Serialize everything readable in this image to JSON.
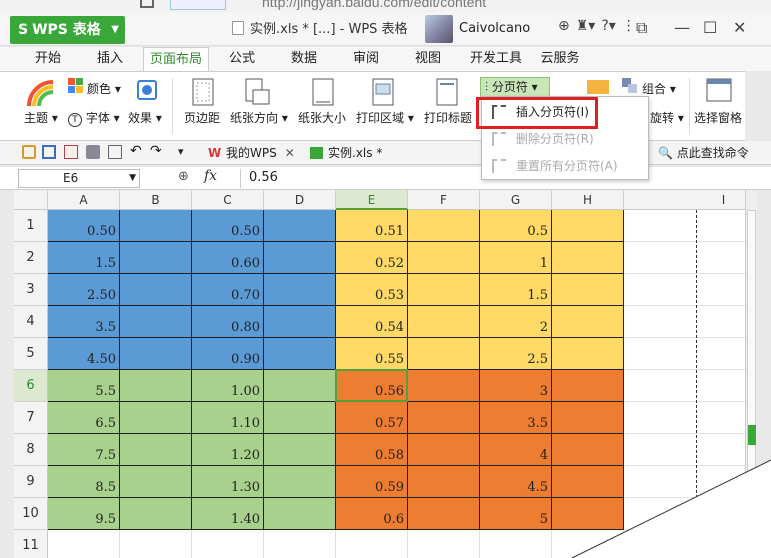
{
  "browser": {
    "url": "http://jingyan.baidu.com/edit/content"
  },
  "titlebar": {
    "app_button": "WPS 表格",
    "doc_title": "实例.xls * [...] - WPS 表格",
    "username": "Caivolcano"
  },
  "tabs": [
    "开始",
    "插入",
    "页面布局",
    "公式",
    "数据",
    "审阅",
    "视图",
    "开发工具",
    "云服务"
  ],
  "active_tab": "页面布局",
  "ribbon": {
    "theme": "主题",
    "color": "颜色",
    "font": "字体",
    "effect": "效果",
    "margins": "页边距",
    "orientation": "纸张方向",
    "size": "纸张大小",
    "print_area": "打印区域",
    "print_titles": "打印标题",
    "page_break": "分页符",
    "group": "组合",
    "rotate": "旋转",
    "selection_pane": "选择窗格"
  },
  "page_break_menu": {
    "insert": "插入分页符(I)",
    "delete": "删除分页符(R)",
    "reset": "重置所有分页符(A)"
  },
  "quickbar": {
    "tab1": "我的WPS",
    "tab2": "实例.xls *",
    "find": "点此查找命令"
  },
  "formula_bar": {
    "cell_ref": "E6",
    "fx": "fx",
    "value": "0.56"
  },
  "columns": [
    "A",
    "B",
    "C",
    "D",
    "E",
    "F",
    "G",
    "H",
    "I"
  ],
  "rows": [
    "1",
    "2",
    "3",
    "4",
    "5",
    "6",
    "7",
    "8",
    "9",
    "10",
    "11"
  ],
  "cells": {
    "A": [
      "0.50",
      "1.5",
      "2.50",
      "3.5",
      "4.50",
      "5.5",
      "6.5",
      "7.5",
      "8.5",
      "9.5"
    ],
    "C": [
      "0.50",
      "0.60",
      "0.70",
      "0.80",
      "0.90",
      "1.00",
      "1.10",
      "1.20",
      "1.30",
      "1.40"
    ],
    "E": [
      "0.51",
      "0.52",
      "0.53",
      "0.54",
      "0.55",
      "0.56",
      "0.57",
      "0.58",
      "0.59",
      "0.6"
    ],
    "G": [
      "0.5",
      "1",
      "1.5",
      "2",
      "2.5",
      "3",
      "3.5",
      "4",
      "4.5",
      "5"
    ]
  },
  "colors": {
    "blue": "#5b9bd5",
    "green": "#a9d18e",
    "yellow": "#ffd966",
    "orange": "#ed7d31",
    "highlight_red": "#e02020",
    "accent_green": "#3aa73a"
  }
}
